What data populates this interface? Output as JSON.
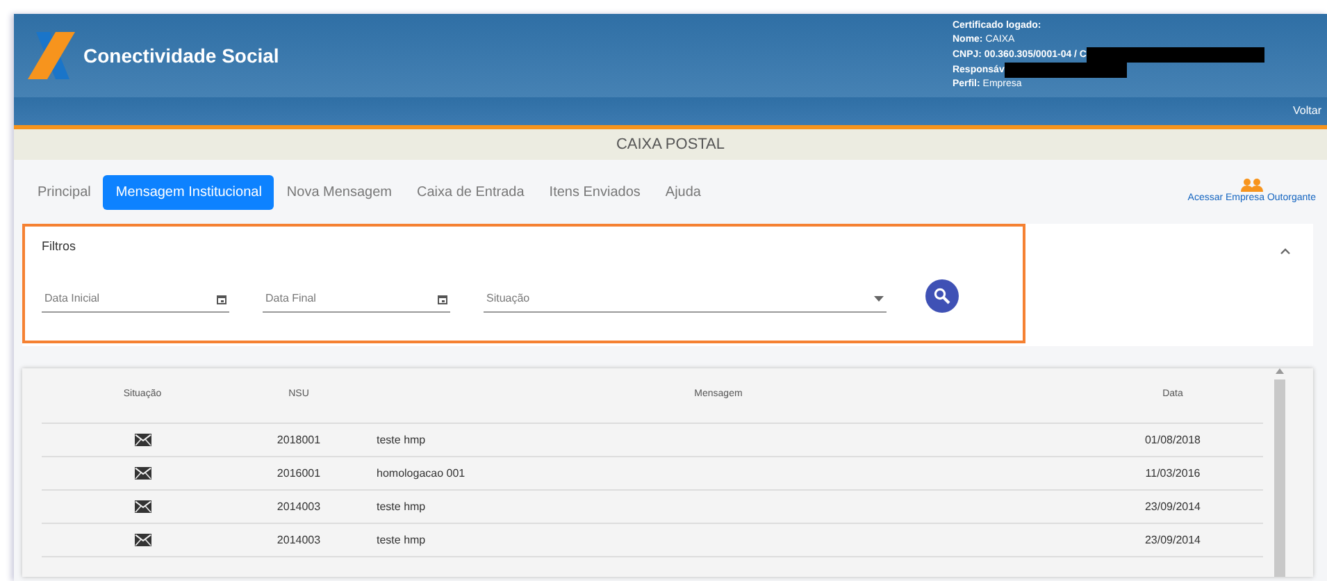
{
  "header": {
    "brand": "Conectividade Social",
    "certificate": [
      {
        "label": "Certificado logado:",
        "redacted": false
      },
      {
        "label": "Nome:",
        "value": "CAIXA",
        "redacted": false
      },
      {
        "label": "CNPJ: 00.360.305/0001-04 / C",
        "redacted": true
      },
      {
        "label": "Responsáv",
        "redacted": true
      },
      {
        "label": "Perfil:",
        "value": "Empresa",
        "redacted": false
      }
    ],
    "back_link": "Voltar"
  },
  "page_title": "CAIXA POSTAL",
  "tabs": [
    {
      "label": "Principal",
      "selected": false
    },
    {
      "label": "Mensagem Institucional",
      "selected": true
    },
    {
      "label": "Nova Mensagem",
      "selected": false
    },
    {
      "label": "Caixa de Entrada",
      "selected": false
    },
    {
      "label": "Itens Enviados",
      "selected": false
    },
    {
      "label": "Ajuda",
      "selected": false
    }
  ],
  "grantor_link": "Acessar Empresa Outorgante",
  "filters": {
    "title": "Filtros",
    "expanded": true,
    "fields": [
      {
        "kind": "date",
        "placeholder": "Data Inicial"
      },
      {
        "kind": "date",
        "placeholder": "Data Final"
      },
      {
        "kind": "select",
        "placeholder": "Situação"
      }
    ]
  },
  "table": {
    "columns": [
      "Situação",
      "NSU",
      "Mensagem",
      "Data"
    ],
    "rows": [
      {
        "nsu": "2018001",
        "message": "teste hmp",
        "date": "01/08/2018"
      },
      {
        "nsu": "2016001",
        "message": "homologacao 001",
        "date": "11/03/2016"
      },
      {
        "nsu": "2014003",
        "message": "teste hmp",
        "date": "23/09/2014"
      },
      {
        "nsu": "2014003",
        "message": "teste hmp",
        "date": "23/09/2014"
      }
    ]
  }
}
